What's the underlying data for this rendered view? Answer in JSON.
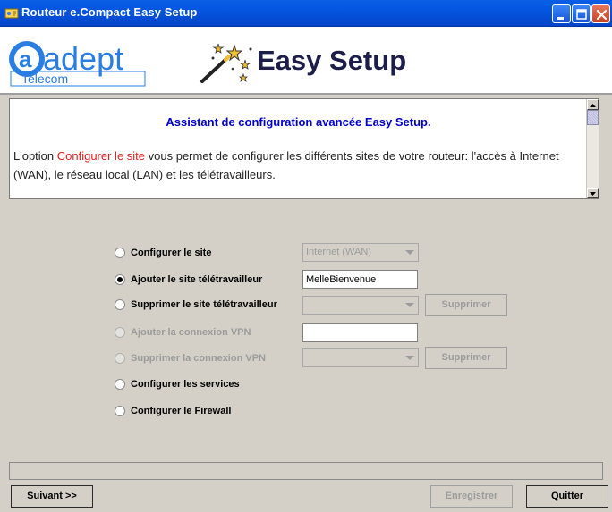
{
  "window": {
    "title": "Routeur e.Compact Easy Setup",
    "icons": [
      "app-icon",
      "minimize-icon",
      "maximize-icon",
      "close-icon"
    ]
  },
  "header": {
    "logo_main": "adept",
    "logo_sub": "Telecom",
    "banner_title": "Easy Setup",
    "icons": [
      "magic-wand-icon"
    ]
  },
  "info": {
    "heading": "Assistant de configuration avancée Easy Setup.",
    "text_prefix": "L'option ",
    "text_highlight": "Configurer le site",
    "text_suffix": " vous permet de configurer les différents sites de votre routeur: l'accès à Internet (WAN), le réseau local (LAN) et les télétravailleurs.",
    "colors": {
      "heading": "#0000cc",
      "highlight": "#e02020"
    }
  },
  "options": [
    {
      "label": "Configurer le site",
      "checked": false,
      "enabled": true
    },
    {
      "label": "Ajouter le site télétravailleur",
      "checked": true,
      "enabled": true
    },
    {
      "label": "Supprimer le site télétravailleur",
      "checked": false,
      "enabled": true
    },
    {
      "label": "Ajouter la connexion VPN",
      "checked": false,
      "enabled": false
    },
    {
      "label": "Supprimer la connexion VPN",
      "checked": false,
      "enabled": false
    },
    {
      "label": "Configurer les services",
      "checked": false,
      "enabled": true
    },
    {
      "label": "Configurer le Firewall",
      "checked": false,
      "enabled": true
    }
  ],
  "controls": {
    "site_combo_value": "Internet (WAN)",
    "teleworker_name_value": "MelleBienvenue",
    "delete_teleworker_button": "Supprimer",
    "delete_vpn_button": "Supprimer",
    "vpn_name_value": ""
  },
  "footer": {
    "next_button": "Suivant >>",
    "save_button": "Enregistrer",
    "quit_button": "Quitter"
  }
}
